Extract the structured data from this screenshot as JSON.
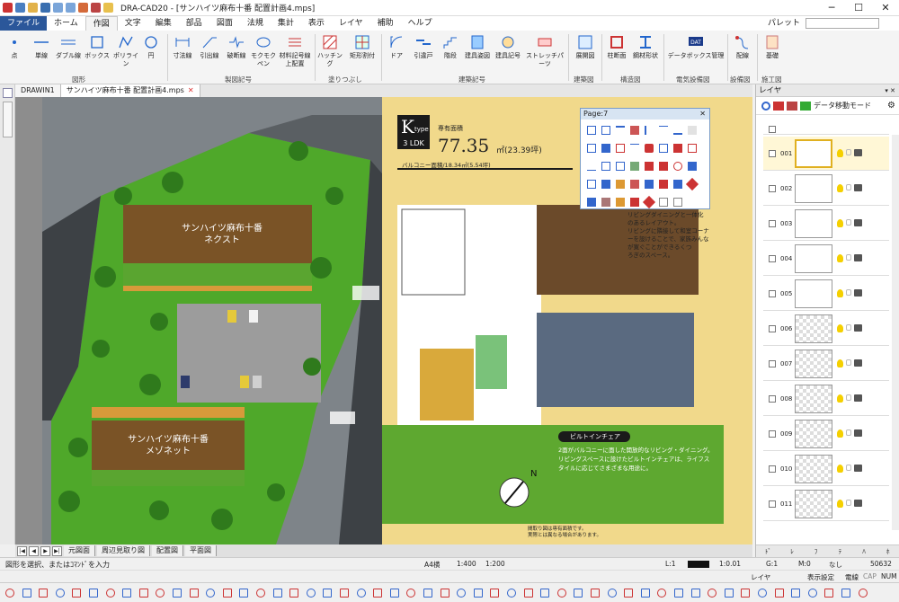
{
  "window": {
    "title": "DRA-CAD20 - [サンハイツ麻布十番 配置計画4.mps]",
    "buttons": [
      "─",
      "☐",
      "✕"
    ]
  },
  "menu": {
    "items": [
      "ファイル",
      "ホーム",
      "作図",
      "文字",
      "編集",
      "部品",
      "図面",
      "法規",
      "集計",
      "表示",
      "レイヤ",
      "補助",
      "ヘルプ"
    ],
    "palette_label": "パレット"
  },
  "ribbon": {
    "buttons": [
      "点",
      "単線",
      "ダブル線",
      "ボックス",
      "ポリライン",
      "円",
      "寸法線",
      "引出線",
      "破断線",
      "モクモクペン",
      "材料記号線上配置",
      "ハッチング",
      "矩形割付",
      "ドア",
      "引違戸",
      "階段",
      "建具姿図",
      "建具記号",
      "ストレッチパーツ",
      "展開図",
      "柱断面",
      "鋼材形状",
      "データボックス管理",
      "配線",
      "基礎"
    ],
    "groups": [
      "図形",
      "製図記号",
      "塗りつぶし",
      "建築記号",
      "建築図",
      "構造図",
      "電気設備図",
      "設備図",
      "施工図"
    ]
  },
  "doc_tabs": [
    {
      "label": "DRAWIN1"
    },
    {
      "label": "サンハイツ麻布十番 配置計画4.mps",
      "close": "✕"
    }
  ],
  "canvas": {
    "building1_line1": "サンハイツ麻布十番",
    "building1_line2": "ネクスト",
    "building2_line1": "サンハイツ麻布十番",
    "building2_line2": "メゾネット",
    "type_k": "K",
    "type_word": "type",
    "ldk": "3 LDK",
    "area_label": "専有面積",
    "area_value": "77.35",
    "area_unit": "㎡(23.39坪)",
    "balcony": "バルコニー面積/18.34㎡(5.54坪)",
    "desc1": "リビングダイニングと一体化",
    "desc2": "のあるレイアウト。",
    "desc3": "リビングに隣接して和室コーナ",
    "desc4": "ーを設けることで、家族みんな",
    "desc5": "が寛ぐことができるくつ",
    "desc6": "ろぎのスペース。",
    "builtin_title": "ビルトインチェア",
    "builtin1": "2面がバルコニーに面した開放的なリビング・ダイニング。",
    "builtin2": "リビングスペースに設けたビルトインチェアは、ライフス",
    "builtin3": "タイルに応じてさまざまな用途に。",
    "note1": "間取り図は専有面積です。",
    "note2": "実際とは異なる場合があります。"
  },
  "page_panel": {
    "title": "Page:7",
    "close": "✕"
  },
  "sheet_tabs": [
    "元図面",
    "周辺見取り図",
    "配置図",
    "平面図"
  ],
  "command_prompt": "図形を選択、またはｺﾏﾝﾄﾞを入力",
  "status": {
    "paper": "A4横",
    "scale1": "1:400",
    "scale2": "1:200",
    "layer_field": "L:1",
    "ratio": "1:0.01",
    "g": "G:1",
    "m": "M:0",
    "none": "なし",
    "count": "50632",
    "disp": "表示設定",
    "mode": "電線",
    "cap": "CAP",
    "num": "NUM",
    "layer_label": "レイヤ"
  },
  "layer_panel": {
    "title": "レイヤ",
    "move_mode": "データ移動モード",
    "rows": [
      "001",
      "002",
      "003",
      "004",
      "005",
      "006",
      "007",
      "008",
      "009",
      "010",
      "011"
    ],
    "bottom_tabs": [
      "ﾄﾞ",
      "ﾚ",
      "ﾌ",
      "ﾃ",
      "ﾊ",
      "ﾎ"
    ]
  }
}
